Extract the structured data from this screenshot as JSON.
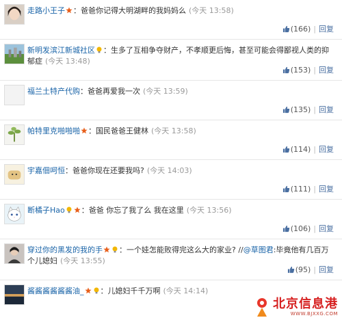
{
  "comments": [
    {
      "user": "走路小王子",
      "badges": [
        "star"
      ],
      "segments": [
        {
          "type": "text",
          "text": "爸爸你记得大明湖畔的我妈妈么"
        }
      ],
      "time": "(今天 13:58)",
      "likes": "(166)",
      "reply_label": "回复",
      "avatar": "face"
    },
    {
      "user": "新明发滨江新城社区",
      "badges": [
        "bulb"
      ],
      "segments": [
        {
          "type": "text",
          "text": "生多了互相争夺财产，不孝顺更后悔，甚至可能会得鄙视人类的抑郁症"
        }
      ],
      "time": "(今天 13:48)",
      "likes": "(153)",
      "reply_label": "回复",
      "avatar": "landscape"
    },
    {
      "user": "福兰土特产代购",
      "badges": [],
      "segments": [
        {
          "type": "text",
          "text": "爸爸再爱我一次"
        }
      ],
      "time": "(今天 13:59)",
      "likes": "(135)",
      "reply_label": "回复",
      "avatar": "blank"
    },
    {
      "user": "帕特里克啪啪啪",
      "badges": [
        "star"
      ],
      "segments": [
        {
          "type": "text",
          "text": "国民爸爸王健林"
        }
      ],
      "time": "(今天 13:58)",
      "likes": "(114)",
      "reply_label": "回复",
      "avatar": "plant"
    },
    {
      "user": "宇嘉佃呵恒",
      "badges": [],
      "segments": [
        {
          "type": "text",
          "text": "爸爸你现在还要我吗?"
        }
      ],
      "time": "(今天 14:03)",
      "likes": "(111)",
      "reply_label": "回复",
      "avatar": "bread"
    },
    {
      "user": "断橘子Hao",
      "badges": [
        "bulb",
        "star"
      ],
      "segments": [
        {
          "type": "text",
          "text": "爸爸 你忘了我了么 我在这里"
        }
      ],
      "time": "(今天 13:56)",
      "likes": "(106)",
      "reply_label": "回复",
      "avatar": "cat"
    },
    {
      "user": "穿过你的黑发的我的手",
      "badges": [
        "star",
        "bulb"
      ],
      "segments": [
        {
          "type": "text",
          "text": "一个娃怎能败得完这么大的家业? //"
        },
        {
          "type": "mention",
          "text": "@草图君"
        },
        {
          "type": "text",
          "text": ":毕竟他有几百万个儿媳妇"
        }
      ],
      "time": "(今天 13:55)",
      "likes": "(95)",
      "reply_label": "回复",
      "avatar": "person"
    },
    {
      "user": "酱酱酱酱酱酱油_",
      "badges": [
        "star",
        "bulb"
      ],
      "segments": [
        {
          "type": "text",
          "text": "儿媳妇千千万啊"
        }
      ],
      "time": "(今天 14:14)",
      "likes": "",
      "reply_label": "",
      "avatar": "sunset"
    }
  ],
  "watermark": {
    "name": "北京信息港",
    "url": "WWW.BJXXG.COM"
  },
  "colors": {
    "username": "#1a64a8",
    "time": "#999999",
    "watermark": "#d61f1f"
  }
}
